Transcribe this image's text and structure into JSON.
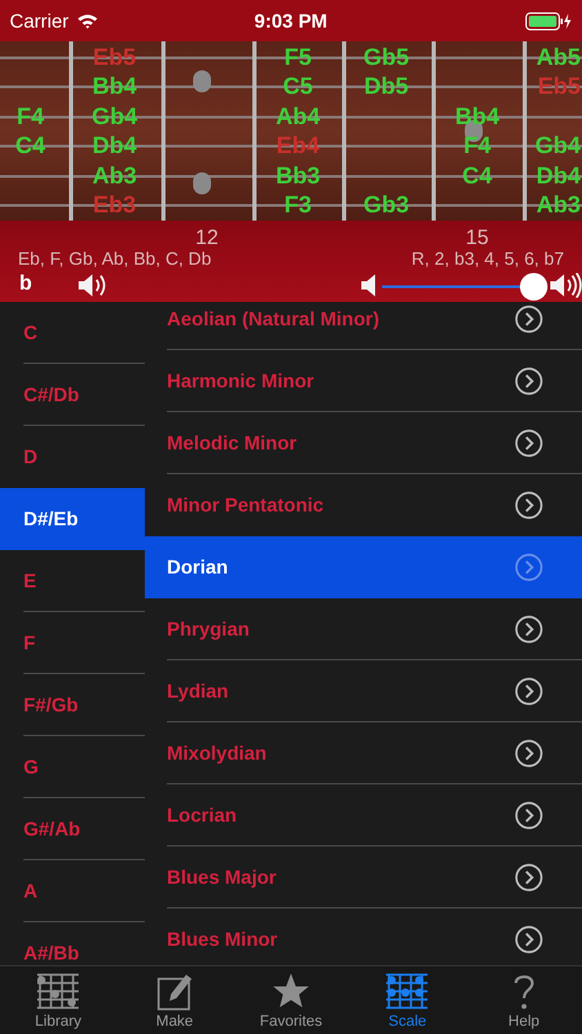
{
  "status_bar": {
    "carrier": "Carrier",
    "time": "9:03 PM"
  },
  "fretboard": {
    "strings": [
      {
        "cells": [
          null,
          {
            "label": "Eb5",
            "root": true
          },
          null,
          {
            "label": "F5",
            "root": false
          },
          {
            "label": "Gb5",
            "root": false
          },
          null,
          {
            "label": "Ab5",
            "root": false
          }
        ]
      },
      {
        "cells": [
          null,
          {
            "label": "Bb4",
            "root": false
          },
          null,
          {
            "label": "C5",
            "root": false
          },
          {
            "label": "Db5",
            "root": false
          },
          null,
          {
            "label": "Eb5",
            "root": true
          }
        ]
      },
      {
        "cells": [
          {
            "label": "F4",
            "root": false
          },
          {
            "label": "Gb4",
            "root": false
          },
          null,
          {
            "label": "Ab4",
            "root": false
          },
          null,
          {
            "label": "Bb4",
            "root": false
          },
          null
        ]
      },
      {
        "cells": [
          {
            "label": "C4",
            "root": false
          },
          {
            "label": "Db4",
            "root": false
          },
          null,
          {
            "label": "Eb4",
            "root": true
          },
          null,
          {
            "label": "F4",
            "root": false
          },
          {
            "label": "Gb4",
            "root": false
          }
        ]
      },
      {
        "cells": [
          null,
          {
            "label": "Ab3",
            "root": false
          },
          null,
          {
            "label": "Bb3",
            "root": false
          },
          null,
          {
            "label": "C4",
            "root": false
          },
          {
            "label": "Db4",
            "root": false
          }
        ]
      },
      {
        "cells": [
          null,
          {
            "label": "Eb3",
            "root": true
          },
          null,
          {
            "label": "F3",
            "root": false
          },
          {
            "label": "Gb3",
            "root": false
          },
          null,
          {
            "label": "Ab3",
            "root": false
          }
        ]
      }
    ],
    "fret_numbers": [
      "12",
      "15"
    ]
  },
  "scale_notes": "Eb, F, Gb, Ab, Bb, C, Db",
  "intervals": "R, 2, b3, 4, 5, 6, b7",
  "accidental_button": "b",
  "volume": {
    "level": 0.93
  },
  "keys": [
    {
      "label": "C",
      "selected": false
    },
    {
      "label": "C#/Db",
      "selected": false
    },
    {
      "label": "D",
      "selected": false
    },
    {
      "label": "D#/Eb",
      "selected": true
    },
    {
      "label": "E",
      "selected": false
    },
    {
      "label": "F",
      "selected": false
    },
    {
      "label": "F#/Gb",
      "selected": false
    },
    {
      "label": "G",
      "selected": false
    },
    {
      "label": "G#/Ab",
      "selected": false
    },
    {
      "label": "A",
      "selected": false
    },
    {
      "label": "A#/Bb",
      "selected": false
    }
  ],
  "scales": [
    {
      "label": "Aeolian (Natural Minor)",
      "selected": false
    },
    {
      "label": "Harmonic Minor",
      "selected": false
    },
    {
      "label": "Melodic Minor",
      "selected": false
    },
    {
      "label": "Minor Pentatonic",
      "selected": false
    },
    {
      "label": "Dorian",
      "selected": true
    },
    {
      "label": "Phrygian",
      "selected": false
    },
    {
      "label": "Lydian",
      "selected": false
    },
    {
      "label": "Mixolydian",
      "selected": false
    },
    {
      "label": "Locrian",
      "selected": false
    },
    {
      "label": "Blues Major",
      "selected": false
    },
    {
      "label": "Blues Minor",
      "selected": false
    }
  ],
  "tabs": [
    {
      "label": "Library",
      "kind": "library",
      "selected": false
    },
    {
      "label": "Make",
      "kind": "make",
      "selected": false
    },
    {
      "label": "Favorites",
      "kind": "favorites",
      "selected": false
    },
    {
      "label": "Scale",
      "kind": "scale",
      "selected": true
    },
    {
      "label": "Help",
      "kind": "help",
      "selected": false
    }
  ]
}
